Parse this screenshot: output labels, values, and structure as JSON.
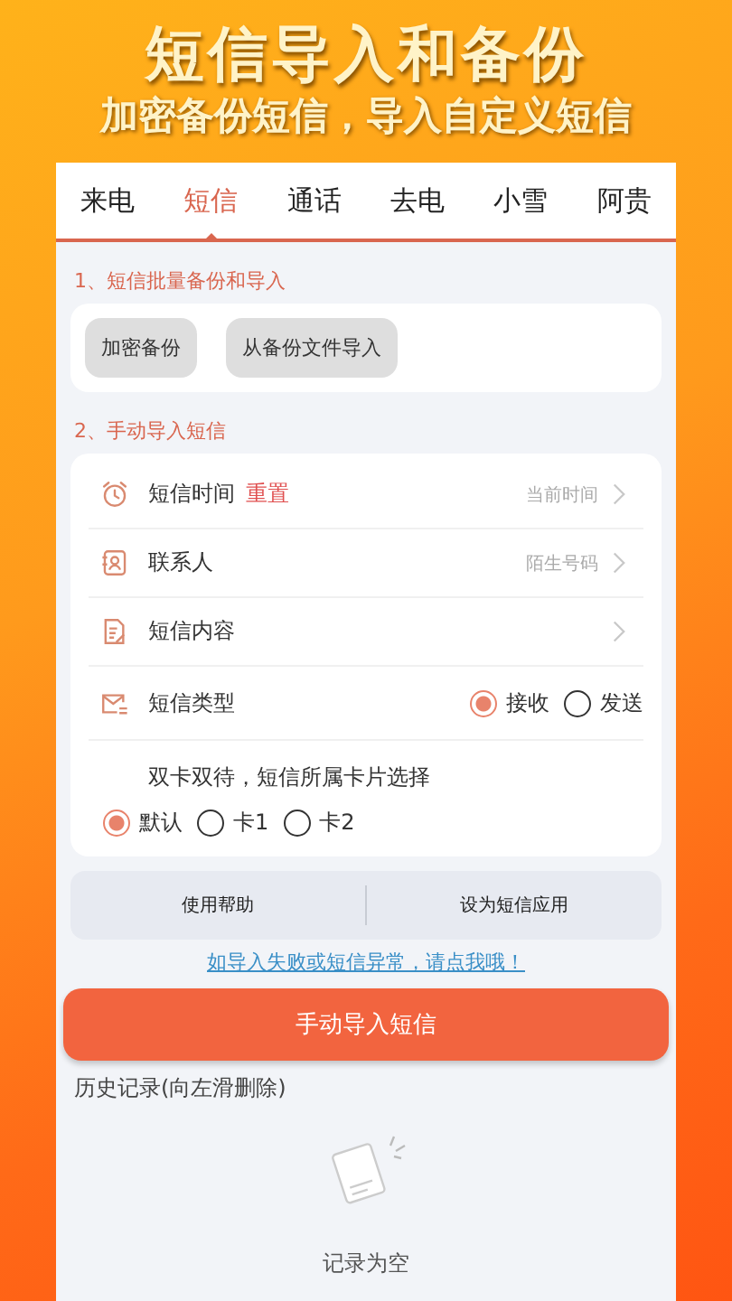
{
  "headline": {
    "title": "短信导入和备份",
    "subtitle": "加密备份短信，导入自定义短信"
  },
  "tabs": [
    {
      "label": "来电",
      "selected": false
    },
    {
      "label": "短信",
      "selected": true
    },
    {
      "label": "通话",
      "selected": false
    },
    {
      "label": "去电",
      "selected": false
    },
    {
      "label": "小雪",
      "selected": false
    },
    {
      "label": "阿贵",
      "selected": false
    }
  ],
  "section_1": {
    "heading": "1、短信批量备份和导入",
    "buttons": [
      "加密备份",
      "从备份文件导入"
    ]
  },
  "section_2": {
    "heading": "2、手动导入短信",
    "rows": [
      {
        "kind": "time",
        "label": "短信时间",
        "action": "重置",
        "value": "当前时间"
      },
      {
        "kind": "contact",
        "label": "联系人",
        "value": "陌生号码"
      },
      {
        "kind": "content",
        "label": "短信内容"
      },
      {
        "kind": "type",
        "label": "短信类型",
        "options": [
          {
            "label": "接收",
            "selected": true
          },
          {
            "label": "发送",
            "selected": false
          }
        ]
      }
    ],
    "sim_prompt": "双卡双待，短信所属卡片选择",
    "sim_options": [
      {
        "label": "默认",
        "selected": true
      },
      {
        "label": "卡1",
        "selected": false
      },
      {
        "label": "卡2",
        "selected": false
      }
    ]
  },
  "footer_buttons": [
    "使用帮助",
    "设为短信应用"
  ],
  "help_link": "如导入失败或短信异常，请点我哦！",
  "primary_button": "手动导入短信",
  "history": {
    "heading": "历史记录(向左滑删除)",
    "empty_text": "记录为空"
  }
}
